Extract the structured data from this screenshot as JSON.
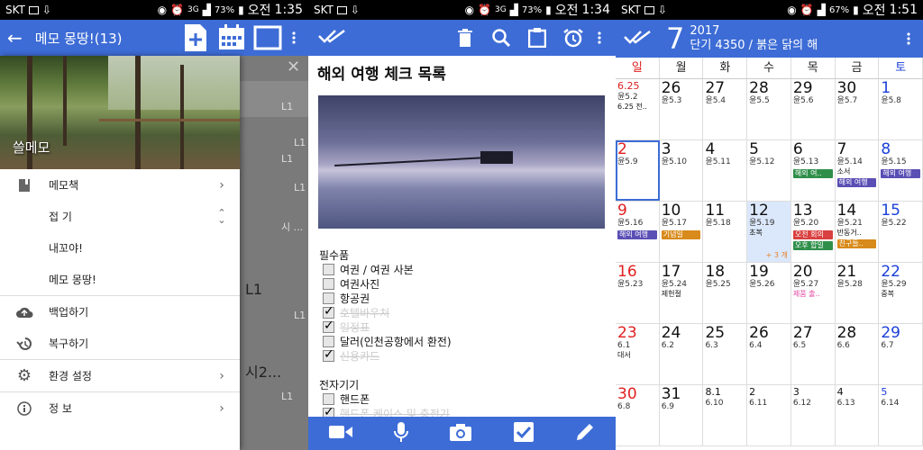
{
  "p1": {
    "status": {
      "carrier": "SKT",
      "net": "3G",
      "battery": "73%",
      "ampm": "오전",
      "time": "1:35"
    },
    "title": "메모 몽땅!(13)",
    "drawer": {
      "header_label": "쓸메모",
      "items": [
        {
          "label": "메모책",
          "icon": "notebook-icon",
          "chevron": "›"
        },
        {
          "label": "접 기",
          "icon": "",
          "chevron": "⌃⌄"
        },
        {
          "label": "내꼬야!",
          "icon": "",
          "chevron": ""
        },
        {
          "label": "메모 몽땅!",
          "icon": "",
          "chevron": ""
        },
        {
          "label": "백업하기",
          "icon": "cloud-upload-icon",
          "chevron": ""
        },
        {
          "label": "복구하기",
          "icon": "history-icon",
          "chevron": ""
        },
        {
          "label": "환경 설정",
          "icon": "gear-icon",
          "chevron": "›"
        },
        {
          "label": "정 보",
          "icon": "info-icon",
          "chevron": "›"
        }
      ]
    },
    "background": {
      "rows": [
        "L1",
        "L1",
        "L1",
        "L1",
        "시 ...",
        "L1",
        "L1",
        "시2...",
        "L1"
      ]
    }
  },
  "p2": {
    "status": {
      "carrier": "SKT",
      "net": "3G",
      "battery": "73%",
      "ampm": "오전",
      "time": "1:34"
    },
    "note_title": "해외 여행 체크 목록",
    "sections": [
      {
        "title": "필수품",
        "items": [
          {
            "text": "여권 / 여권 사본",
            "checked": false
          },
          {
            "text": "여권사진",
            "checked": false
          },
          {
            "text": "항공권",
            "checked": false
          },
          {
            "text": "호텔바우처",
            "checked": true
          },
          {
            "text": "일정표",
            "checked": true
          },
          {
            "text": "달러(인천공항에서 환전)",
            "checked": false
          },
          {
            "text": "신용카드",
            "checked": true
          }
        ]
      },
      {
        "title": "전자기기",
        "items": [
          {
            "text": "핸드폰",
            "checked": false
          },
          {
            "text": "핸드폰 케이스 및 충전기",
            "checked": true
          }
        ]
      }
    ]
  },
  "p3": {
    "status": {
      "carrier": "SKT",
      "battery": "67%",
      "ampm": "오전",
      "time": "1:51"
    },
    "month": "7",
    "year": "2017",
    "subtitle": "단기 4350 / 붉은 닭의 해",
    "weekdays": [
      "일",
      "월",
      "화",
      "수",
      "목",
      "금",
      "토"
    ],
    "colors": {
      "sun": "#e02020",
      "sat": "#1a3fd8",
      "accent": "#3d6cd6",
      "purple": "#5a4fb5",
      "green": "#2f8f4a",
      "red": "#d94040",
      "orange": "#d88a1a",
      "pink": "#e040a0"
    },
    "weeks": [
      [
        {
          "d": "6.25",
          "lu": "윤5.2",
          "ev": "6.25 전..",
          "red": true,
          "small": true
        },
        {
          "d": "26",
          "lu": "윤5.3"
        },
        {
          "d": "27",
          "lu": "윤5.4"
        },
        {
          "d": "28",
          "lu": "윤5.5"
        },
        {
          "d": "29",
          "lu": "윤5.6"
        },
        {
          "d": "30",
          "lu": "윤5.7"
        },
        {
          "d": "1",
          "lu": "윤5.8",
          "blue": true
        }
      ],
      [
        {
          "d": "2",
          "lu": "윤5.9",
          "red": true,
          "sel": true
        },
        {
          "d": "3",
          "lu": "윤5.10"
        },
        {
          "d": "4",
          "lu": "윤5.11"
        },
        {
          "d": "5",
          "lu": "윤5.12"
        },
        {
          "d": "6",
          "lu": "윤5.13",
          "tags": [
            {
              "t": "해외 여..",
              "c": "#2f8f4a"
            }
          ]
        },
        {
          "d": "7",
          "lu": "윤5.14",
          "ev": "소서",
          "tags": [
            {
              "t": "해외 여행",
              "c": "#5a4fb5"
            }
          ]
        },
        {
          "d": "8",
          "lu": "윤5.15",
          "blue": true,
          "tags": [
            {
              "t": "해외 여행",
              "c": "#5a4fb5"
            }
          ]
        }
      ],
      [
        {
          "d": "9",
          "lu": "윤5.16",
          "red": true,
          "tags": [
            {
              "t": "해외 여행",
              "c": "#5a4fb5"
            }
          ]
        },
        {
          "d": "10",
          "lu": "윤5.17",
          "tags": [
            {
              "t": "기념일",
              "c": "#d88a1a"
            }
          ]
        },
        {
          "d": "11",
          "lu": "윤5.18"
        },
        {
          "d": "12",
          "lu": "윤5.19",
          "ev": "초복",
          "today": true,
          "more": "+ 3 개"
        },
        {
          "d": "13",
          "lu": "윤5.20",
          "tags": [
            {
              "t": "오전 회의",
              "c": "#d94040"
            },
            {
              "t": "오후 합일",
              "c": "#2f8f4a"
            }
          ]
        },
        {
          "d": "14",
          "lu": "윤5.21",
          "ev": "반동거..",
          "tags": [
            {
              "t": "친구들..",
              "c": "#d88a1a"
            }
          ]
        },
        {
          "d": "15",
          "lu": "윤5.22",
          "blue": true
        }
      ],
      [
        {
          "d": "16",
          "lu": "윤5.23",
          "red": true
        },
        {
          "d": "17",
          "lu": "윤5.24",
          "ev": "제헌절"
        },
        {
          "d": "18",
          "lu": "윤5.25"
        },
        {
          "d": "19",
          "lu": "윤5.26"
        },
        {
          "d": "20",
          "lu": "윤5.27",
          "pinkev": "제품 출.."
        },
        {
          "d": "21",
          "lu": "윤5.28"
        },
        {
          "d": "22",
          "lu": "윤5.29",
          "blue": true,
          "ev": "중복"
        }
      ],
      [
        {
          "d": "23",
          "lu": "6.1",
          "red": true,
          "ev": "대서"
        },
        {
          "d": "24",
          "lu": "6.2"
        },
        {
          "d": "25",
          "lu": "6.3"
        },
        {
          "d": "26",
          "lu": "6.4"
        },
        {
          "d": "27",
          "lu": "6.5"
        },
        {
          "d": "28",
          "lu": "6.6"
        },
        {
          "d": "29",
          "lu": "6.7",
          "blue": true
        }
      ],
      [
        {
          "d": "30",
          "lu": "6.8",
          "red": true
        },
        {
          "d": "31",
          "lu": "6.9"
        },
        {
          "d": "8.1",
          "lu": "6.10",
          "small": true
        },
        {
          "d": "2",
          "lu": "6.11",
          "small": true
        },
        {
          "d": "3",
          "lu": "6.12",
          "small": true
        },
        {
          "d": "4",
          "lu": "6.13",
          "small": true
        },
        {
          "d": "5",
          "lu": "6.14",
          "blue": true,
          "small": true
        }
      ]
    ]
  }
}
